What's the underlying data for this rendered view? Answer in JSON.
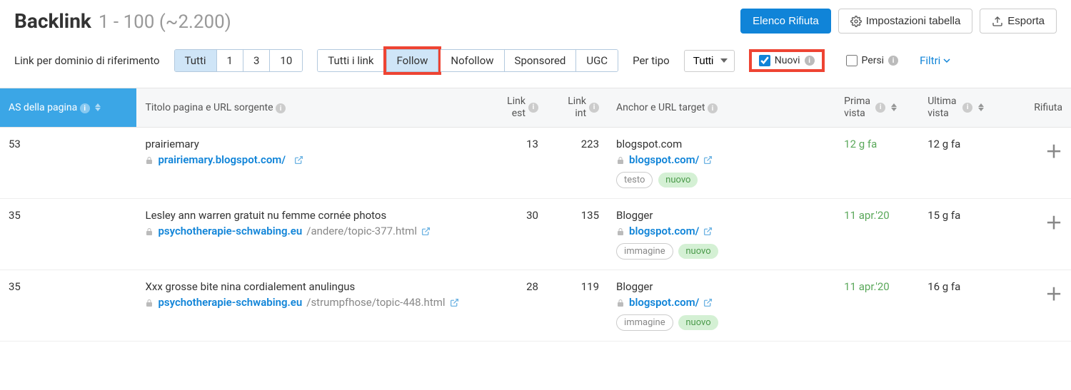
{
  "header": {
    "title": "Backlink",
    "subtitle": "1 - 100 (~2.200)",
    "buttons": {
      "reject_list": "Elenco Rifiuta",
      "table_settings": "Impostazioni tabella",
      "export": "Esporta"
    }
  },
  "filters": {
    "per_domain_label": "Link per dominio di riferimento",
    "per_domain_opts": [
      "Tutti",
      "1",
      "3",
      "10"
    ],
    "link_type_opts": [
      "Tutti i link",
      "Follow",
      "Nofollow",
      "Sponsored",
      "UGC"
    ],
    "per_type_label": "Per tipo",
    "per_type_value": "Tutti",
    "new_label": "Nuovi",
    "lost_label": "Persi",
    "filters_link": "Filtri"
  },
  "columns": {
    "as": "AS della pagina",
    "title_url": "Titolo pagina e URL sorgente",
    "link_est": "Link est",
    "link_int": "Link int",
    "anchor": "Anchor e URL target",
    "first_seen": "Prima vista",
    "last_seen": "Ultima vista",
    "reject": "Rifiuta"
  },
  "rows": [
    {
      "as": "53",
      "title": "prairiemary",
      "url_domain": "prairiemary.blogspot.com/",
      "url_path": "",
      "link_est": "13",
      "link_int": "223",
      "anchor_text": "blogspot.com",
      "anchor_url_domain": "blogspot.com/",
      "anchor_url_path": "",
      "badge_type": "testo",
      "badge_status": "nuovo",
      "first_seen": "12 g fa",
      "first_seen_green": true,
      "last_seen": "12 g fa"
    },
    {
      "as": "35",
      "title": "Lesley ann warren gratuit nu femme cornée photos",
      "url_domain": "psychotherapie-schwabing.eu",
      "url_path": "/andere/topic-377.html",
      "link_est": "30",
      "link_int": "135",
      "anchor_text": "Blogger",
      "anchor_url_domain": "blogspot.com/",
      "anchor_url_path": "",
      "badge_type": "immagine",
      "badge_status": "nuovo",
      "first_seen": "11 apr.'20",
      "first_seen_green": true,
      "last_seen": "15 g fa"
    },
    {
      "as": "35",
      "title": "Xxx grosse bite nina cordialement anulingus",
      "url_domain": "psychotherapie-schwabing.eu",
      "url_path": "/strumpfhose/topic-448.html",
      "link_est": "28",
      "link_int": "119",
      "anchor_text": "Blogger",
      "anchor_url_domain": "blogspot.com/",
      "anchor_url_path": "",
      "badge_type": "immagine",
      "badge_status": "nuovo",
      "first_seen": "11 apr.'20",
      "first_seen_green": true,
      "last_seen": "16 g fa"
    }
  ]
}
